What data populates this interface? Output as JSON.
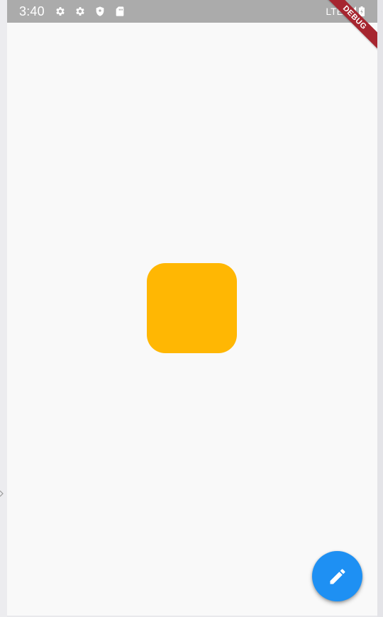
{
  "status_bar": {
    "time": "3:40",
    "left_icons": [
      "settings-icon",
      "settings-icon",
      "shield-icon",
      "sim-card-icon"
    ],
    "network_label": "LTE",
    "signal_icon": "signal-icon",
    "battery_icon": "battery-charging-icon",
    "background_color": "#ababab"
  },
  "debug_banner": {
    "label": "DEBUG",
    "color": "#a6252f"
  },
  "content": {
    "box_color": "#ffb703",
    "background_color": "#f9f9f9"
  },
  "fab": {
    "icon": "edit-icon",
    "color": "#1e90f3"
  }
}
